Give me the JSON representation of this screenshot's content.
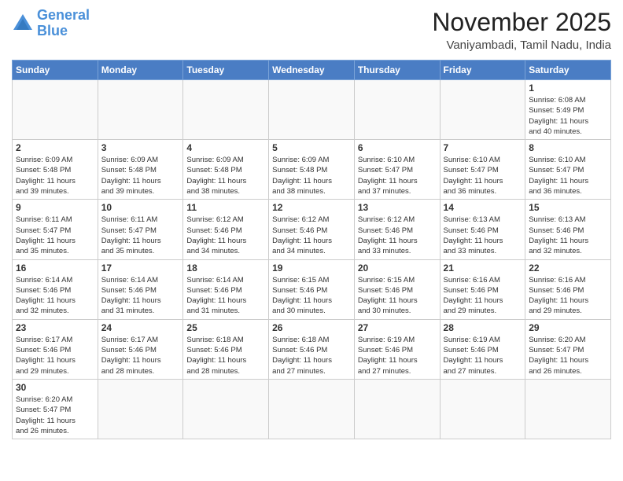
{
  "header": {
    "logo_general": "General",
    "logo_blue": "Blue",
    "month_title": "November 2025",
    "location": "Vaniyambadi, Tamil Nadu, India"
  },
  "days_of_week": [
    "Sunday",
    "Monday",
    "Tuesday",
    "Wednesday",
    "Thursday",
    "Friday",
    "Saturday"
  ],
  "cells": [
    {
      "day": null,
      "text": ""
    },
    {
      "day": null,
      "text": ""
    },
    {
      "day": null,
      "text": ""
    },
    {
      "day": null,
      "text": ""
    },
    {
      "day": null,
      "text": ""
    },
    {
      "day": null,
      "text": ""
    },
    {
      "day": "1",
      "text": "Sunrise: 6:08 AM\nSunset: 5:49 PM\nDaylight: 11 hours\nand 40 minutes."
    },
    {
      "day": "2",
      "text": "Sunrise: 6:09 AM\nSunset: 5:48 PM\nDaylight: 11 hours\nand 39 minutes."
    },
    {
      "day": "3",
      "text": "Sunrise: 6:09 AM\nSunset: 5:48 PM\nDaylight: 11 hours\nand 39 minutes."
    },
    {
      "day": "4",
      "text": "Sunrise: 6:09 AM\nSunset: 5:48 PM\nDaylight: 11 hours\nand 38 minutes."
    },
    {
      "day": "5",
      "text": "Sunrise: 6:09 AM\nSunset: 5:48 PM\nDaylight: 11 hours\nand 38 minutes."
    },
    {
      "day": "6",
      "text": "Sunrise: 6:10 AM\nSunset: 5:47 PM\nDaylight: 11 hours\nand 37 minutes."
    },
    {
      "day": "7",
      "text": "Sunrise: 6:10 AM\nSunset: 5:47 PM\nDaylight: 11 hours\nand 36 minutes."
    },
    {
      "day": "8",
      "text": "Sunrise: 6:10 AM\nSunset: 5:47 PM\nDaylight: 11 hours\nand 36 minutes."
    },
    {
      "day": "9",
      "text": "Sunrise: 6:11 AM\nSunset: 5:47 PM\nDaylight: 11 hours\nand 35 minutes."
    },
    {
      "day": "10",
      "text": "Sunrise: 6:11 AM\nSunset: 5:47 PM\nDaylight: 11 hours\nand 35 minutes."
    },
    {
      "day": "11",
      "text": "Sunrise: 6:12 AM\nSunset: 5:46 PM\nDaylight: 11 hours\nand 34 minutes."
    },
    {
      "day": "12",
      "text": "Sunrise: 6:12 AM\nSunset: 5:46 PM\nDaylight: 11 hours\nand 34 minutes."
    },
    {
      "day": "13",
      "text": "Sunrise: 6:12 AM\nSunset: 5:46 PM\nDaylight: 11 hours\nand 33 minutes."
    },
    {
      "day": "14",
      "text": "Sunrise: 6:13 AM\nSunset: 5:46 PM\nDaylight: 11 hours\nand 33 minutes."
    },
    {
      "day": "15",
      "text": "Sunrise: 6:13 AM\nSunset: 5:46 PM\nDaylight: 11 hours\nand 32 minutes."
    },
    {
      "day": "16",
      "text": "Sunrise: 6:14 AM\nSunset: 5:46 PM\nDaylight: 11 hours\nand 32 minutes."
    },
    {
      "day": "17",
      "text": "Sunrise: 6:14 AM\nSunset: 5:46 PM\nDaylight: 11 hours\nand 31 minutes."
    },
    {
      "day": "18",
      "text": "Sunrise: 6:14 AM\nSunset: 5:46 PM\nDaylight: 11 hours\nand 31 minutes."
    },
    {
      "day": "19",
      "text": "Sunrise: 6:15 AM\nSunset: 5:46 PM\nDaylight: 11 hours\nand 30 minutes."
    },
    {
      "day": "20",
      "text": "Sunrise: 6:15 AM\nSunset: 5:46 PM\nDaylight: 11 hours\nand 30 minutes."
    },
    {
      "day": "21",
      "text": "Sunrise: 6:16 AM\nSunset: 5:46 PM\nDaylight: 11 hours\nand 29 minutes."
    },
    {
      "day": "22",
      "text": "Sunrise: 6:16 AM\nSunset: 5:46 PM\nDaylight: 11 hours\nand 29 minutes."
    },
    {
      "day": "23",
      "text": "Sunrise: 6:17 AM\nSunset: 5:46 PM\nDaylight: 11 hours\nand 29 minutes."
    },
    {
      "day": "24",
      "text": "Sunrise: 6:17 AM\nSunset: 5:46 PM\nDaylight: 11 hours\nand 28 minutes."
    },
    {
      "day": "25",
      "text": "Sunrise: 6:18 AM\nSunset: 5:46 PM\nDaylight: 11 hours\nand 28 minutes."
    },
    {
      "day": "26",
      "text": "Sunrise: 6:18 AM\nSunset: 5:46 PM\nDaylight: 11 hours\nand 27 minutes."
    },
    {
      "day": "27",
      "text": "Sunrise: 6:19 AM\nSunset: 5:46 PM\nDaylight: 11 hours\nand 27 minutes."
    },
    {
      "day": "28",
      "text": "Sunrise: 6:19 AM\nSunset: 5:46 PM\nDaylight: 11 hours\nand 27 minutes."
    },
    {
      "day": "29",
      "text": "Sunrise: 6:20 AM\nSunset: 5:47 PM\nDaylight: 11 hours\nand 26 minutes."
    },
    {
      "day": "30",
      "text": "Sunrise: 6:20 AM\nSunset: 5:47 PM\nDaylight: 11 hours\nand 26 minutes."
    }
  ]
}
